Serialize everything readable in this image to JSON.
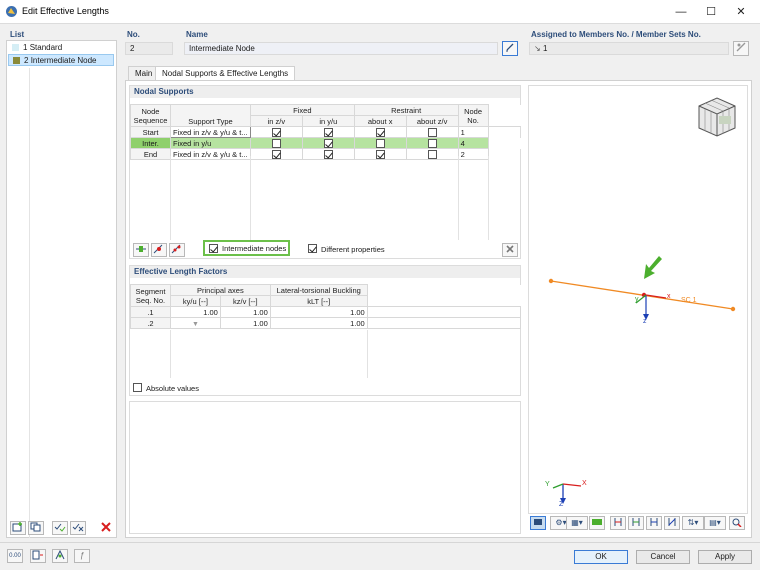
{
  "window": {
    "title": "Edit Effective Lengths",
    "minimize": "—",
    "maximize": "☐",
    "close": "✕"
  },
  "list": {
    "title": "List",
    "items": [
      {
        "no": "1",
        "name": "Standard",
        "color": "#d5eef5"
      },
      {
        "no": "2",
        "name": "Intermediate Node",
        "color": "#8a8a3a"
      }
    ]
  },
  "header": {
    "no_label": "No.",
    "no_value": "2",
    "name_label": "Name",
    "name_value": "Intermediate Node",
    "assigned_label": "Assigned to Members No. / Member Sets No.",
    "assigned_value": "1"
  },
  "tabs": [
    {
      "label": "Main"
    },
    {
      "label": "Nodal Supports & Effective Lengths"
    }
  ],
  "nodal_supports": {
    "title": "Nodal Supports",
    "head": {
      "node_sequence": "Node Sequence",
      "node_sequence_l1": "Node",
      "node_sequence_l2": "Sequence",
      "support_type": "Support Type",
      "fixed": "Fixed",
      "in_zv": "in z/v",
      "in_yu": "in y/u",
      "restraint": "Restraint",
      "about_x": "about x",
      "about_zv": "about z/v",
      "node_no_l1": "Node",
      "node_no_l2": "No."
    },
    "rows": [
      {
        "seq": "Start",
        "type": "Fixed in z/v & y/u & t...",
        "fz": true,
        "fy": true,
        "rx": true,
        "rz": false,
        "node": "1"
      },
      {
        "seq": "Inter.",
        "type": "Fixed in y/u",
        "fz": false,
        "fy": true,
        "rx": false,
        "rz": false,
        "node": "4"
      },
      {
        "seq": "End",
        "type": "Fixed in z/v & y/u & t...",
        "fz": true,
        "fy": true,
        "rx": true,
        "rz": false,
        "node": "2"
      }
    ],
    "intermediate_nodes": "Intermediate nodes",
    "different_properties": "Different properties"
  },
  "elf": {
    "title": "Effective Length Factors",
    "head": {
      "segment_l1": "Segment",
      "segment_l2": "Seq. No.",
      "principal_axes": "Principal axes",
      "ky": "ky/u [--]",
      "kz": "kz/v [--]",
      "ltb": "Lateral-torsional Buckling",
      "klt": "kLT [--]"
    },
    "rows": [
      {
        "seg": ".1",
        "ky": "1.00",
        "kz": "1.00",
        "klt": "1.00"
      },
      {
        "seg": ".2",
        "ky": "",
        "kz": "1.00",
        "klt": "1.00"
      }
    ],
    "absolute_values": "Absolute values"
  },
  "viewport": {
    "member_label": "SC 1",
    "axis_y": "y",
    "axis_x": "x",
    "axis_z": "z",
    "global_y": "Y",
    "global_x": "X",
    "global_z": "Z",
    "member_color": "#f08a24",
    "arrow_color": "#4caf2e"
  },
  "buttons": {
    "ok": "OK",
    "cancel": "Cancel",
    "apply": "Apply",
    "zero_value": "0.00"
  },
  "colors": {
    "accent": "#2d4d7a",
    "highlight_row": "#b6e3a0",
    "selected_list": "#cde8ff"
  }
}
